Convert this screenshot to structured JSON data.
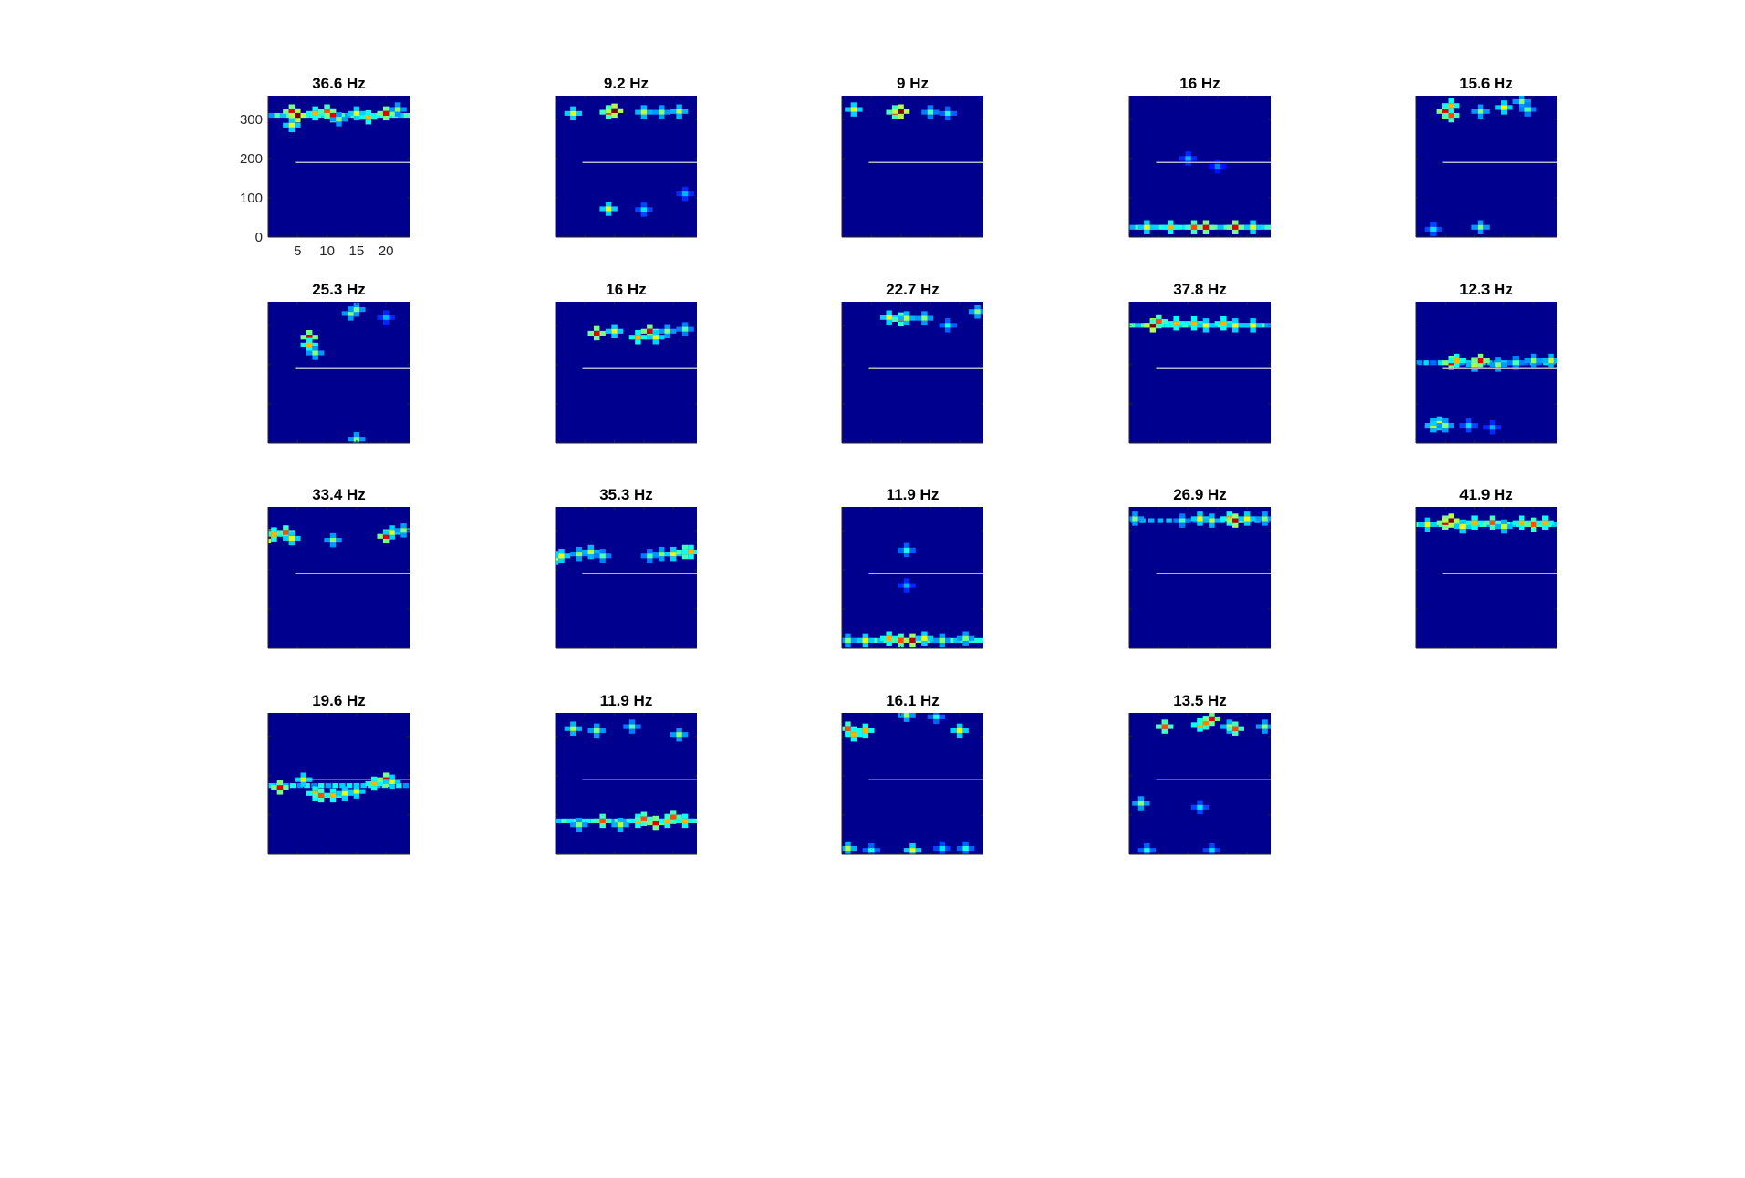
{
  "figure": {
    "colormap": "jet",
    "background_color": "#00008F",
    "reference_line_color": "#B4B4CC",
    "reference_line_y": 190
  },
  "chart_data": [
    {
      "type": "heatmap",
      "title": "36.6 Hz",
      "xlim": [
        0,
        24
      ],
      "ylim": [
        0,
        360
      ],
      "xticks": [
        5,
        10,
        15,
        20
      ],
      "yticks": [
        0,
        100,
        200,
        300
      ],
      "show_tick_labels": true,
      "points": [
        [
          4,
          320,
          0.9
        ],
        [
          5,
          310,
          1
        ],
        [
          4,
          285,
          0.6
        ],
        [
          8,
          315,
          0.7
        ],
        [
          10,
          320,
          0.8
        ],
        [
          11,
          310,
          0.9
        ],
        [
          12,
          300,
          0.5
        ],
        [
          15,
          315,
          0.6
        ],
        [
          17,
          305,
          0.7
        ],
        [
          20,
          315,
          0.9
        ],
        [
          22,
          325,
          0.5
        ]
      ],
      "band": {
        "y": 310,
        "count": 24,
        "level": 0.45
      }
    },
    {
      "type": "heatmap",
      "title": "9.2 Hz",
      "xlim": [
        0,
        24
      ],
      "ylim": [
        0,
        360
      ],
      "xticks": [
        5,
        10,
        15,
        20
      ],
      "yticks": [
        0,
        100,
        200,
        300
      ],
      "points": [
        [
          3,
          315,
          0.6
        ],
        [
          9,
          318,
          0.8
        ],
        [
          10,
          322,
          1
        ],
        [
          15,
          318,
          0.55
        ],
        [
          18,
          318,
          0.5
        ],
        [
          21,
          320,
          0.55
        ],
        [
          9,
          72,
          0.6
        ],
        [
          15,
          70,
          0.35
        ],
        [
          22,
          110,
          0.3
        ]
      ],
      "band": null
    },
    {
      "type": "heatmap",
      "title": "9 Hz",
      "xlim": [
        0,
        24
      ],
      "ylim": [
        0,
        360
      ],
      "xticks": [
        5,
        10,
        15,
        20
      ],
      "yticks": [
        0,
        100,
        200,
        300
      ],
      "points": [
        [
          2,
          325,
          0.6
        ],
        [
          9,
          318,
          0.8
        ],
        [
          10,
          320,
          1
        ],
        [
          15,
          318,
          0.45
        ],
        [
          18,
          315,
          0.4
        ]
      ],
      "band": null
    },
    {
      "type": "heatmap",
      "title": "16 Hz",
      "xlim": [
        0,
        24
      ],
      "ylim": [
        0,
        360
      ],
      "xticks": [
        5,
        10,
        15,
        20
      ],
      "yticks": [
        0,
        100,
        200,
        300
      ],
      "points": [
        [
          3,
          25,
          0.6
        ],
        [
          7,
          25,
          0.7
        ],
        [
          11,
          25,
          0.8
        ],
        [
          13,
          25,
          0.9
        ],
        [
          18,
          25,
          0.9
        ],
        [
          21,
          25,
          0.6
        ],
        [
          10,
          200,
          0.3
        ],
        [
          15,
          180,
          0.25
        ]
      ],
      "band": {
        "y": 25,
        "count": 24,
        "level": 0.45
      }
    },
    {
      "type": "heatmap",
      "title": "15.6 Hz",
      "xlim": [
        0,
        24
      ],
      "ylim": [
        0,
        360
      ],
      "xticks": [
        5,
        10,
        15,
        20
      ],
      "yticks": [
        0,
        100,
        200,
        300
      ],
      "points": [
        [
          5,
          320,
          0.9
        ],
        [
          6,
          310,
          0.8
        ],
        [
          6,
          335,
          0.7
        ],
        [
          11,
          320,
          0.5
        ],
        [
          15,
          330,
          0.6
        ],
        [
          18,
          345,
          0.5
        ],
        [
          19,
          325,
          0.45
        ],
        [
          3,
          20,
          0.35
        ],
        [
          11,
          25,
          0.5
        ]
      ],
      "band": null
    },
    {
      "type": "heatmap",
      "title": "25.3 Hz",
      "xlim": [
        0,
        24
      ],
      "ylim": [
        0,
        360
      ],
      "xticks": [
        5,
        10,
        15,
        20
      ],
      "yticks": [
        0,
        100,
        200,
        300
      ],
      "points": [
        [
          7,
          270,
          0.9
        ],
        [
          7,
          250,
          0.7
        ],
        [
          8,
          230,
          0.5
        ],
        [
          14,
          330,
          0.5
        ],
        [
          15,
          340,
          0.5
        ],
        [
          20,
          320,
          0.3
        ],
        [
          15,
          10,
          0.5
        ]
      ],
      "band": null
    },
    {
      "type": "heatmap",
      "title": "16 Hz",
      "xlim": [
        0,
        24
      ],
      "ylim": [
        0,
        360
      ],
      "xticks": [
        5,
        10,
        15,
        20
      ],
      "yticks": [
        0,
        100,
        200,
        300
      ],
      "points": [
        [
          7,
          280,
          0.9
        ],
        [
          10,
          285,
          0.6
        ],
        [
          14,
          270,
          0.7
        ],
        [
          16,
          285,
          0.9
        ],
        [
          17,
          270,
          0.6
        ],
        [
          19,
          285,
          0.5
        ],
        [
          22,
          290,
          0.45
        ]
      ],
      "band": null
    },
    {
      "type": "heatmap",
      "title": "22.7 Hz",
      "xlim": [
        0,
        24
      ],
      "ylim": [
        0,
        360
      ],
      "xticks": [
        5,
        10,
        15,
        20
      ],
      "yticks": [
        0,
        100,
        200,
        300
      ],
      "points": [
        [
          8,
          320,
          0.6
        ],
        [
          10,
          315,
          0.8
        ],
        [
          11,
          318,
          0.55
        ],
        [
          14,
          318,
          0.5
        ],
        [
          18,
          300,
          0.4
        ],
        [
          23,
          335,
          0.5
        ]
      ],
      "band": null
    },
    {
      "type": "heatmap",
      "title": "37.8 Hz",
      "xlim": [
        0,
        24
      ],
      "ylim": [
        0,
        360
      ],
      "xticks": [
        5,
        10,
        15,
        20
      ],
      "yticks": [
        0,
        100,
        200,
        300
      ],
      "points": [
        [
          4,
          300,
          1
        ],
        [
          5,
          310,
          0.8
        ],
        [
          8,
          305,
          0.7
        ],
        [
          11,
          305,
          0.7
        ],
        [
          13,
          300,
          0.6
        ],
        [
          16,
          305,
          0.7
        ],
        [
          18,
          300,
          0.6
        ],
        [
          21,
          300,
          0.6
        ]
      ],
      "band": {
        "y": 300,
        "count": 24,
        "level": 0.45
      }
    },
    {
      "type": "heatmap",
      "title": "12.3 Hz",
      "xlim": [
        0,
        24
      ],
      "ylim": [
        0,
        360
      ],
      "xticks": [
        5,
        10,
        15,
        20
      ],
      "yticks": [
        0,
        100,
        200,
        300
      ],
      "points": [
        [
          6,
          205,
          0.9
        ],
        [
          7,
          210,
          0.7
        ],
        [
          10,
          200,
          0.55
        ],
        [
          11,
          210,
          0.9
        ],
        [
          14,
          200,
          0.5
        ],
        [
          17,
          205,
          0.45
        ],
        [
          20,
          210,
          0.5
        ],
        [
          23,
          210,
          0.55
        ],
        [
          3,
          45,
          0.55
        ],
        [
          4,
          50,
          0.6
        ],
        [
          5,
          45,
          0.5
        ],
        [
          9,
          45,
          0.35
        ],
        [
          13,
          40,
          0.3
        ]
      ],
      "band": {
        "y": 205,
        "count": 20,
        "level": 0.35
      }
    },
    {
      "type": "heatmap",
      "title": "33.4 Hz",
      "xlim": [
        0,
        24
      ],
      "ylim": [
        0,
        360
      ],
      "xticks": [
        5,
        10,
        15,
        20
      ],
      "yticks": [
        0,
        100,
        200,
        300
      ],
      "points": [
        [
          0,
          285,
          1
        ],
        [
          1,
          290,
          0.7
        ],
        [
          3,
          295,
          0.8
        ],
        [
          4,
          280,
          0.6
        ],
        [
          11,
          275,
          0.5
        ],
        [
          20,
          285,
          0.9
        ],
        [
          21,
          295,
          0.6
        ],
        [
          23,
          300,
          0.5
        ]
      ],
      "band": null
    },
    {
      "type": "heatmap",
      "title": "35.3 Hz",
      "xlim": [
        0,
        24
      ],
      "ylim": [
        0,
        360
      ],
      "xticks": [
        5,
        10,
        15,
        20
      ],
      "yticks": [
        0,
        100,
        200,
        300
      ],
      "points": [
        [
          0,
          230,
          0.6
        ],
        [
          1,
          235,
          0.6
        ],
        [
          4,
          240,
          0.5
        ],
        [
          6,
          245,
          0.55
        ],
        [
          8,
          235,
          0.45
        ],
        [
          16,
          235,
          0.45
        ],
        [
          18,
          240,
          0.5
        ],
        [
          20,
          240,
          0.6
        ],
        [
          22,
          245,
          0.8
        ],
        [
          23,
          245,
          0.7
        ]
      ],
      "band": null
    },
    {
      "type": "heatmap",
      "title": "11.9 Hz",
      "xlim": [
        0,
        24
      ],
      "ylim": [
        0,
        360
      ],
      "xticks": [
        5,
        10,
        15,
        20
      ],
      "yticks": [
        0,
        100,
        200,
        300
      ],
      "points": [
        [
          1,
          20,
          0.5
        ],
        [
          4,
          20,
          0.6
        ],
        [
          8,
          25,
          0.7
        ],
        [
          10,
          20,
          0.8
        ],
        [
          12,
          20,
          0.95
        ],
        [
          14,
          25,
          0.6
        ],
        [
          17,
          20,
          0.5
        ],
        [
          21,
          25,
          0.5
        ],
        [
          11,
          250,
          0.4
        ],
        [
          11,
          160,
          0.3
        ]
      ],
      "band": {
        "y": 20,
        "count": 24,
        "level": 0.45
      }
    },
    {
      "type": "heatmap",
      "title": "26.9 Hz",
      "xlim": [
        0,
        24
      ],
      "ylim": [
        0,
        360
      ],
      "xticks": [
        5,
        10,
        15,
        20
      ],
      "yticks": [
        0,
        100,
        200,
        300
      ],
      "points": [
        [
          1,
          330,
          0.5
        ],
        [
          9,
          325,
          0.45
        ],
        [
          12,
          330,
          0.6
        ],
        [
          14,
          325,
          0.55
        ],
        [
          17,
          330,
          0.7
        ],
        [
          18,
          325,
          0.95
        ],
        [
          20,
          330,
          0.6
        ],
        [
          23,
          330,
          0.5
        ]
      ],
      "band": {
        "y": 325,
        "count": 16,
        "level": 0.35
      }
    },
    {
      "type": "heatmap",
      "title": "41.9 Hz",
      "xlim": [
        0,
        24
      ],
      "ylim": [
        0,
        360
      ],
      "xticks": [
        5,
        10,
        15,
        20
      ],
      "yticks": [
        0,
        100,
        200,
        300
      ],
      "points": [
        [
          2,
          315,
          0.6
        ],
        [
          5,
          320,
          0.9
        ],
        [
          6,
          325,
          1
        ],
        [
          8,
          310,
          0.6
        ],
        [
          10,
          320,
          0.7
        ],
        [
          13,
          320,
          0.8
        ],
        [
          15,
          310,
          0.55
        ],
        [
          18,
          320,
          0.7
        ],
        [
          20,
          315,
          0.8
        ],
        [
          22,
          320,
          0.7
        ]
      ],
      "band": {
        "y": 315,
        "count": 24,
        "level": 0.45
      }
    },
    {
      "type": "heatmap",
      "title": "19.6 Hz",
      "xlim": [
        0,
        24
      ],
      "ylim": [
        0,
        360
      ],
      "xticks": [
        5,
        10,
        15,
        20
      ],
      "yticks": [
        0,
        100,
        200,
        300
      ],
      "points": [
        [
          2,
          170,
          0.9
        ],
        [
          6,
          190,
          0.6
        ],
        [
          8,
          155,
          0.7
        ],
        [
          9,
          150,
          0.8
        ],
        [
          11,
          150,
          0.7
        ],
        [
          13,
          155,
          0.6
        ],
        [
          15,
          160,
          0.6
        ],
        [
          18,
          180,
          0.7
        ],
        [
          20,
          190,
          0.9
        ],
        [
          21,
          185,
          0.6
        ]
      ],
      "band": {
        "y": 175,
        "count": 20,
        "level": 0.4
      }
    },
    {
      "type": "heatmap",
      "title": "11.9 Hz",
      "xlim": [
        0,
        24
      ],
      "ylim": [
        0,
        360
      ],
      "xticks": [
        5,
        10,
        15,
        20
      ],
      "yticks": [
        0,
        100,
        200,
        300
      ],
      "points": [
        [
          3,
          320,
          0.55
        ],
        [
          7,
          315,
          0.5
        ],
        [
          13,
          325,
          0.45
        ],
        [
          21,
          305,
          0.5
        ],
        [
          4,
          75,
          0.5
        ],
        [
          8,
          85,
          0.8
        ],
        [
          11,
          75,
          0.55
        ],
        [
          14,
          85,
          0.7
        ],
        [
          15,
          90,
          0.8
        ],
        [
          17,
          80,
          0.9
        ],
        [
          19,
          85,
          0.7
        ],
        [
          20,
          95,
          0.8
        ],
        [
          22,
          85,
          0.7
        ]
      ],
      "band": {
        "y": 85,
        "count": 24,
        "level": 0.45
      }
    },
    {
      "type": "heatmap",
      "title": "16.1 Hz",
      "xlim": [
        0,
        24
      ],
      "ylim": [
        0,
        360
      ],
      "xticks": [
        5,
        10,
        15,
        20
      ],
      "yticks": [
        0,
        100,
        200,
        300
      ],
      "points": [
        [
          1,
          320,
          0.8
        ],
        [
          2,
          305,
          0.7
        ],
        [
          4,
          315,
          0.7
        ],
        [
          20,
          315,
          0.6
        ],
        [
          11,
          355,
          0.5
        ],
        [
          16,
          350,
          0.4
        ],
        [
          1,
          15,
          0.55
        ],
        [
          5,
          10,
          0.4
        ],
        [
          12,
          10,
          0.6
        ],
        [
          17,
          15,
          0.35
        ],
        [
          21,
          15,
          0.4
        ]
      ],
      "band": null
    },
    {
      "type": "heatmap",
      "title": "13.5 Hz",
      "xlim": [
        0,
        24
      ],
      "ylim": [
        0,
        360
      ],
      "xticks": [
        5,
        10,
        15,
        20
      ],
      "yticks": [
        0,
        100,
        200,
        300
      ],
      "points": [
        [
          6,
          325,
          0.8
        ],
        [
          12,
          330,
          0.7
        ],
        [
          13,
          335,
          0.75
        ],
        [
          14,
          345,
          0.9
        ],
        [
          17,
          325,
          0.55
        ],
        [
          18,
          320,
          0.8
        ],
        [
          23,
          325,
          0.5
        ],
        [
          2,
          130,
          0.5
        ],
        [
          12,
          120,
          0.35
        ],
        [
          3,
          10,
          0.4
        ],
        [
          14,
          10,
          0.35
        ]
      ],
      "band": null
    }
  ]
}
